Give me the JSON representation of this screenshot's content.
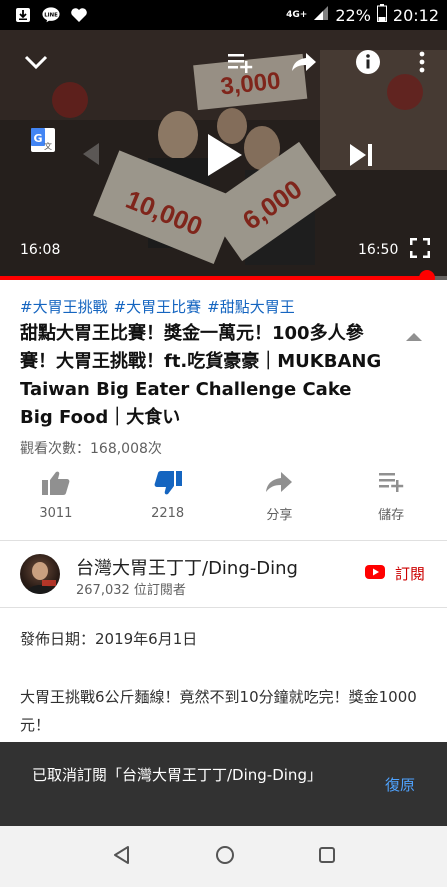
{
  "status_bar": {
    "network": "4G+",
    "battery": "22%",
    "time": "20:12"
  },
  "player": {
    "current_time": "16:08",
    "duration": "16:50",
    "progress": 0.955
  },
  "video": {
    "hashtags": [
      "#大胃王挑戰",
      "#大胃王比賽",
      "#甜點大胃王"
    ],
    "title": "甜點大胃王比賽！獎金一萬元！100多人參賽！大胃王挑戰！ft.吃貨豪豪｜MUKBANG Taiwan Big Eater Challenge Cake Big Food｜大食い",
    "views": "觀看次數：168,008次"
  },
  "actions": [
    {
      "icon": "thumbs-up-icon",
      "label": "3011"
    },
    {
      "icon": "thumbs-down-icon",
      "label": "2218"
    },
    {
      "icon": "share-icon",
      "label": "分享"
    },
    {
      "icon": "save-to-playlist-icon",
      "label": "儲存"
    }
  ],
  "channel": {
    "name": "台灣大胃王丁丁/Ding-Ding",
    "subscribers": "267,032 位訂閱者",
    "subscribe_label": "訂閱"
  },
  "description": {
    "publish_date": "發佈日期：2019年6月1日",
    "text": "大胃王挑戰6公斤麵線！竟然不到10分鐘就吃完！獎金1000元！"
  },
  "snackbar": {
    "message": "已取消訂閱「台灣大胃王丁丁/Ding-Ding」",
    "action": "復原"
  },
  "colors": {
    "accent_red": "#ff0000",
    "link_blue": "#1565c0",
    "dislike_blue": "#1565c0",
    "snackbar_bg": "#323232",
    "snackbar_action": "#4fa3ff"
  }
}
